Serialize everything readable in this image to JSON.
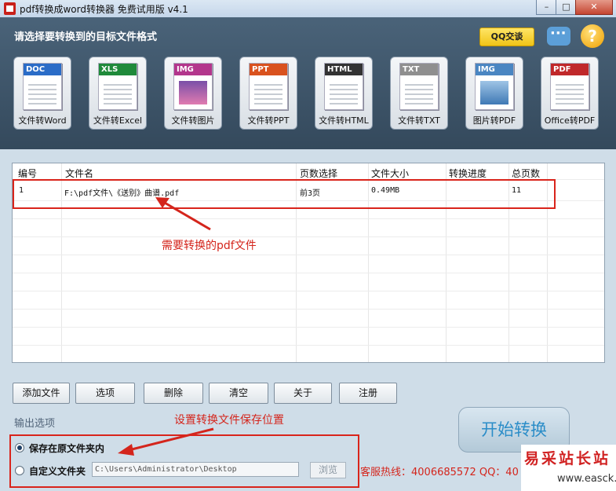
{
  "window": {
    "title": "pdf转换成word转换器 免费试用版 v4.1",
    "controls": [
      "–",
      "□",
      "✕"
    ]
  },
  "header": {
    "prompt": "请选择要转换到的目标文件格式",
    "qq_button": "QQ交谈",
    "formats": [
      {
        "badge": "DOC",
        "label": "文件转Word",
        "color": "#2a6cc7"
      },
      {
        "badge": "XLS",
        "label": "文件转Excel",
        "color": "#1f8a3a"
      },
      {
        "badge": "IMG",
        "label": "文件转图片",
        "color": "#b3368c"
      },
      {
        "badge": "PPT",
        "label": "文件转PPT",
        "color": "#d9521e"
      },
      {
        "badge": "HTML",
        "label": "文件转HTML",
        "color": "#333333"
      },
      {
        "badge": "TXT",
        "label": "文件转TXT",
        "color": "#8f8f8f"
      },
      {
        "badge": "IMG",
        "label": "图片转PDF",
        "color": "#4a86c2"
      },
      {
        "badge": "PDF",
        "label": "Office转PDF",
        "color": "#c0282a"
      }
    ]
  },
  "file_table": {
    "columns": [
      "编号",
      "文件名",
      "页数选择",
      "文件大小",
      "转换进度",
      "总页数"
    ],
    "rows": [
      {
        "index": "1",
        "filename": "F:\\pdf文件\\《送别》曲谱.pdf",
        "pages": "前3页",
        "size": "0.49MB",
        "progress": "",
        "total": "11"
      }
    ]
  },
  "annotations": {
    "file_note": "需要转换的pdf文件",
    "save_note": "设置转换文件保存位置"
  },
  "toolbar": {
    "add_file": "添加文件",
    "options": "选项",
    "delete": "删除",
    "clear": "清空",
    "about": "关于",
    "register": "注册"
  },
  "output": {
    "section_title": "输出选项",
    "save_in_source": "保存在原文件夹内",
    "custom_folder": "自定义文件夹",
    "custom_path": "C:\\Users\\Administrator\\Desktop",
    "browse": "浏览",
    "save_in_source_selected": true
  },
  "start_button": "开始转换",
  "hotline": "客服热线：4006685572 QQ：40",
  "watermark": {
    "text": "易采站长站",
    "url": "www.easck.com"
  }
}
